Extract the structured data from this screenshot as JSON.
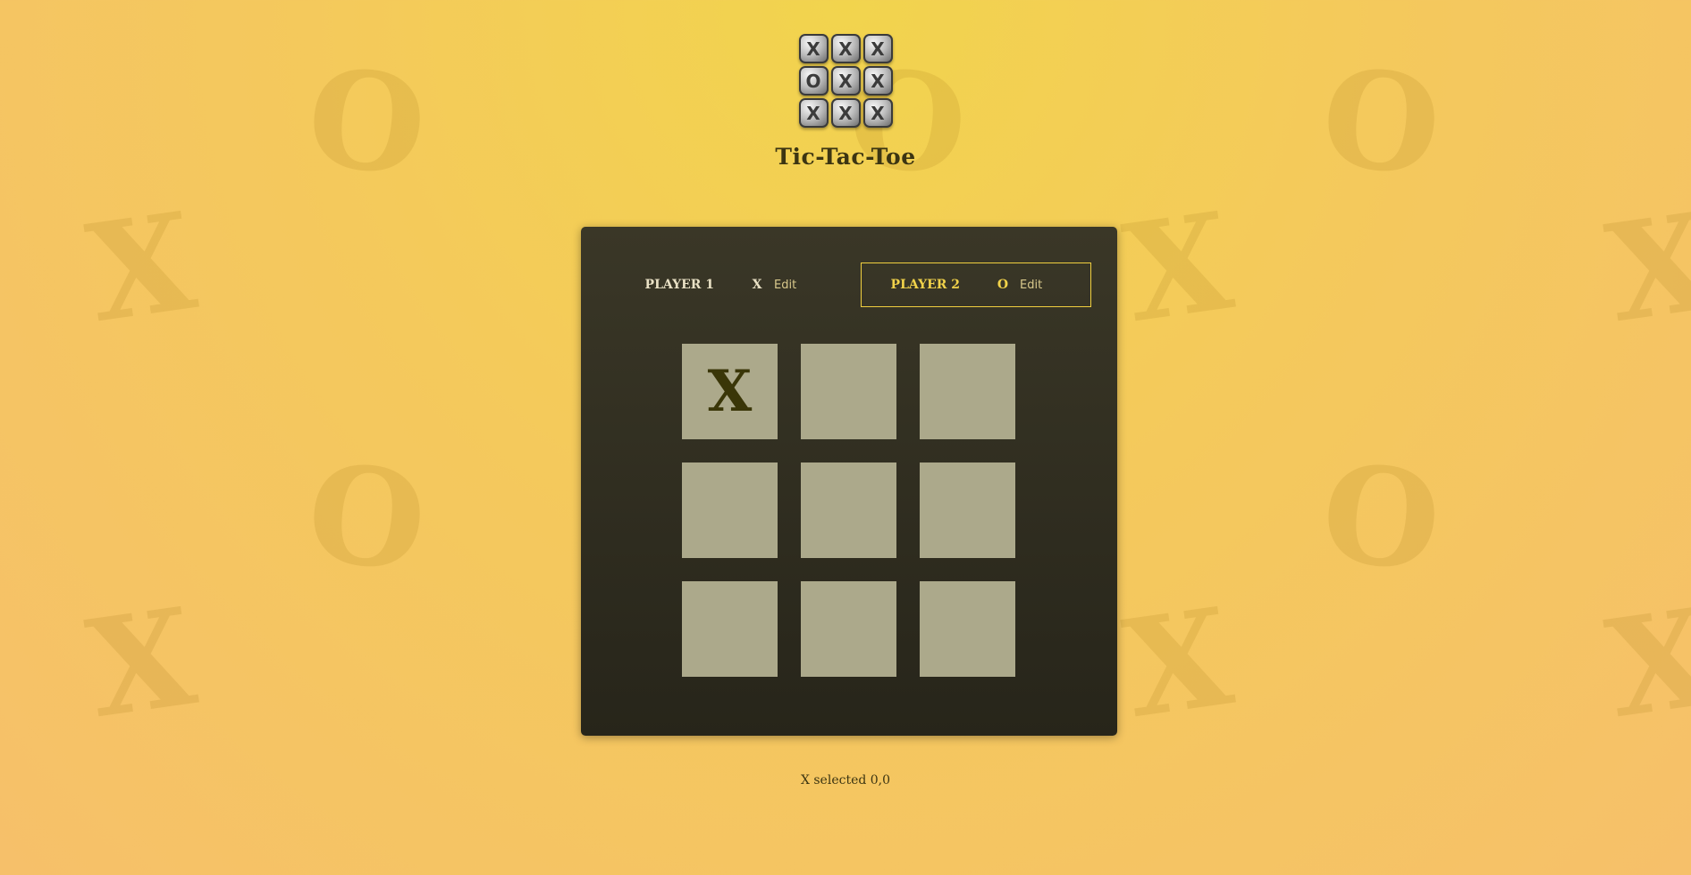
{
  "app": {
    "title": "Tic-Tac-Toe",
    "logo_tiles": [
      "X",
      "X",
      "X",
      "O",
      "X",
      "X",
      "X",
      "X",
      "X"
    ]
  },
  "players": [
    {
      "name": "Player 1",
      "symbol": "X",
      "edit_label": "Edit",
      "active": false
    },
    {
      "name": "Player 2",
      "symbol": "O",
      "edit_label": "Edit",
      "active": true
    }
  ],
  "board": {
    "cells": [
      "X",
      "",
      "",
      "",
      "",
      "",
      "",
      "",
      ""
    ]
  },
  "status": "X selected 0,0",
  "colors": {
    "accent": "#f0cf3f",
    "panel": "#2f2d1f",
    "cell": "#aca98b",
    "mark": "#3a3608"
  }
}
